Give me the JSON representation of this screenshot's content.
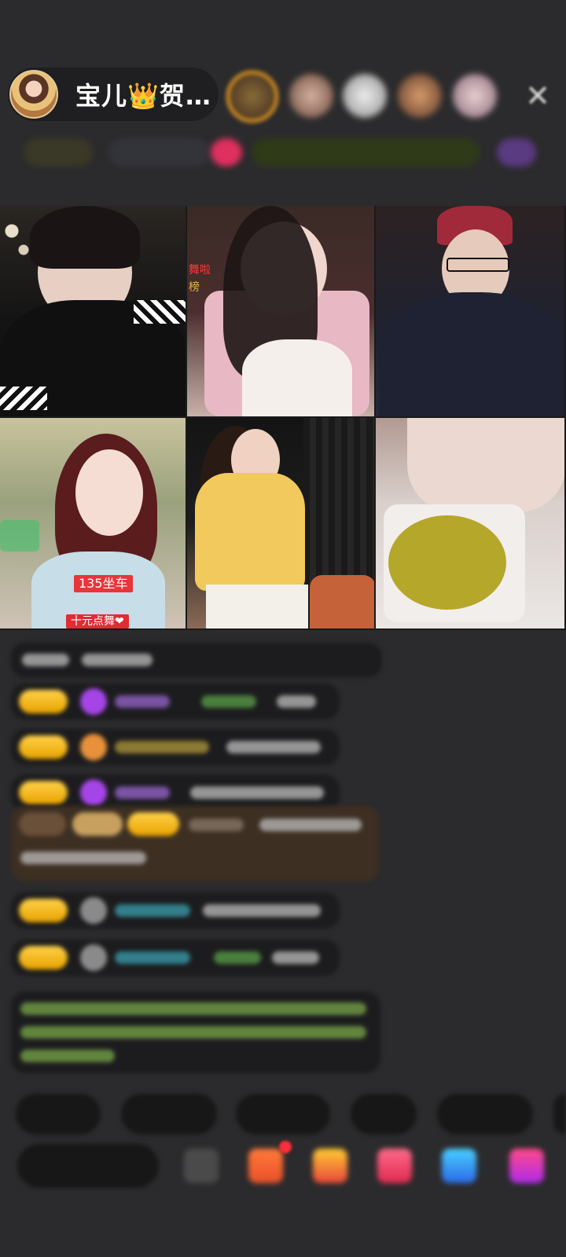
{
  "header": {
    "host_name": "宝儿👑贺…",
    "close_label": "✕"
  },
  "grid": {
    "tile2_label_top": "舞啦",
    "tile2_label_bottom": "榜",
    "tile4_tag_top": "135坐车",
    "tile4_tag_bottom": "十元点舞❤"
  },
  "colors": {
    "background": "#2b2b2d",
    "badge_gold": "#f0b400",
    "tag_red": "#e8353a",
    "chat_bubble": "#1c1c1e"
  },
  "icons": [
    "crown-icon",
    "close-icon",
    "gift-icon",
    "emoji-icon",
    "more-icon"
  ]
}
